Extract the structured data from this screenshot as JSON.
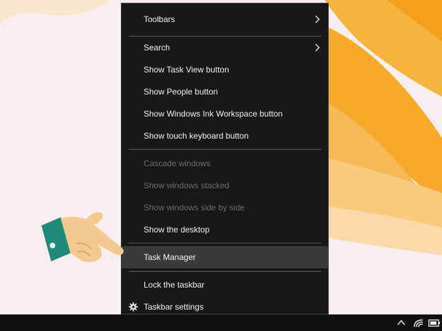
{
  "menu": {
    "items": [
      {
        "label": "Toolbars"
      },
      {
        "label": "Search"
      },
      {
        "label": "Show Task View button"
      },
      {
        "label": "Show People button"
      },
      {
        "label": "Show Windows Ink Workspace button"
      },
      {
        "label": "Show touch keyboard button"
      },
      {
        "label": "Cascade windows"
      },
      {
        "label": "Show windows stacked"
      },
      {
        "label": "Show windows side by side"
      },
      {
        "label": "Show the desktop"
      },
      {
        "label": "Task Manager"
      },
      {
        "label": "Lock the taskbar"
      },
      {
        "label": "Taskbar settings"
      }
    ]
  },
  "icons": {
    "submenu": "chevron-right-icon",
    "settings": "gear-icon",
    "pointer": "pointing-hand-icon",
    "tray_overflow": "chevron-up-icon",
    "network": "wifi-icon",
    "battery": "battery-icon"
  },
  "colors": {
    "menu_bg": "#181818",
    "menu_text": "#f2f2f2",
    "disabled_text": "#6e6e6e",
    "highlight_bg": "#3a3a3a",
    "petal": "#f5a623",
    "taskbar_bg": "#111111"
  }
}
